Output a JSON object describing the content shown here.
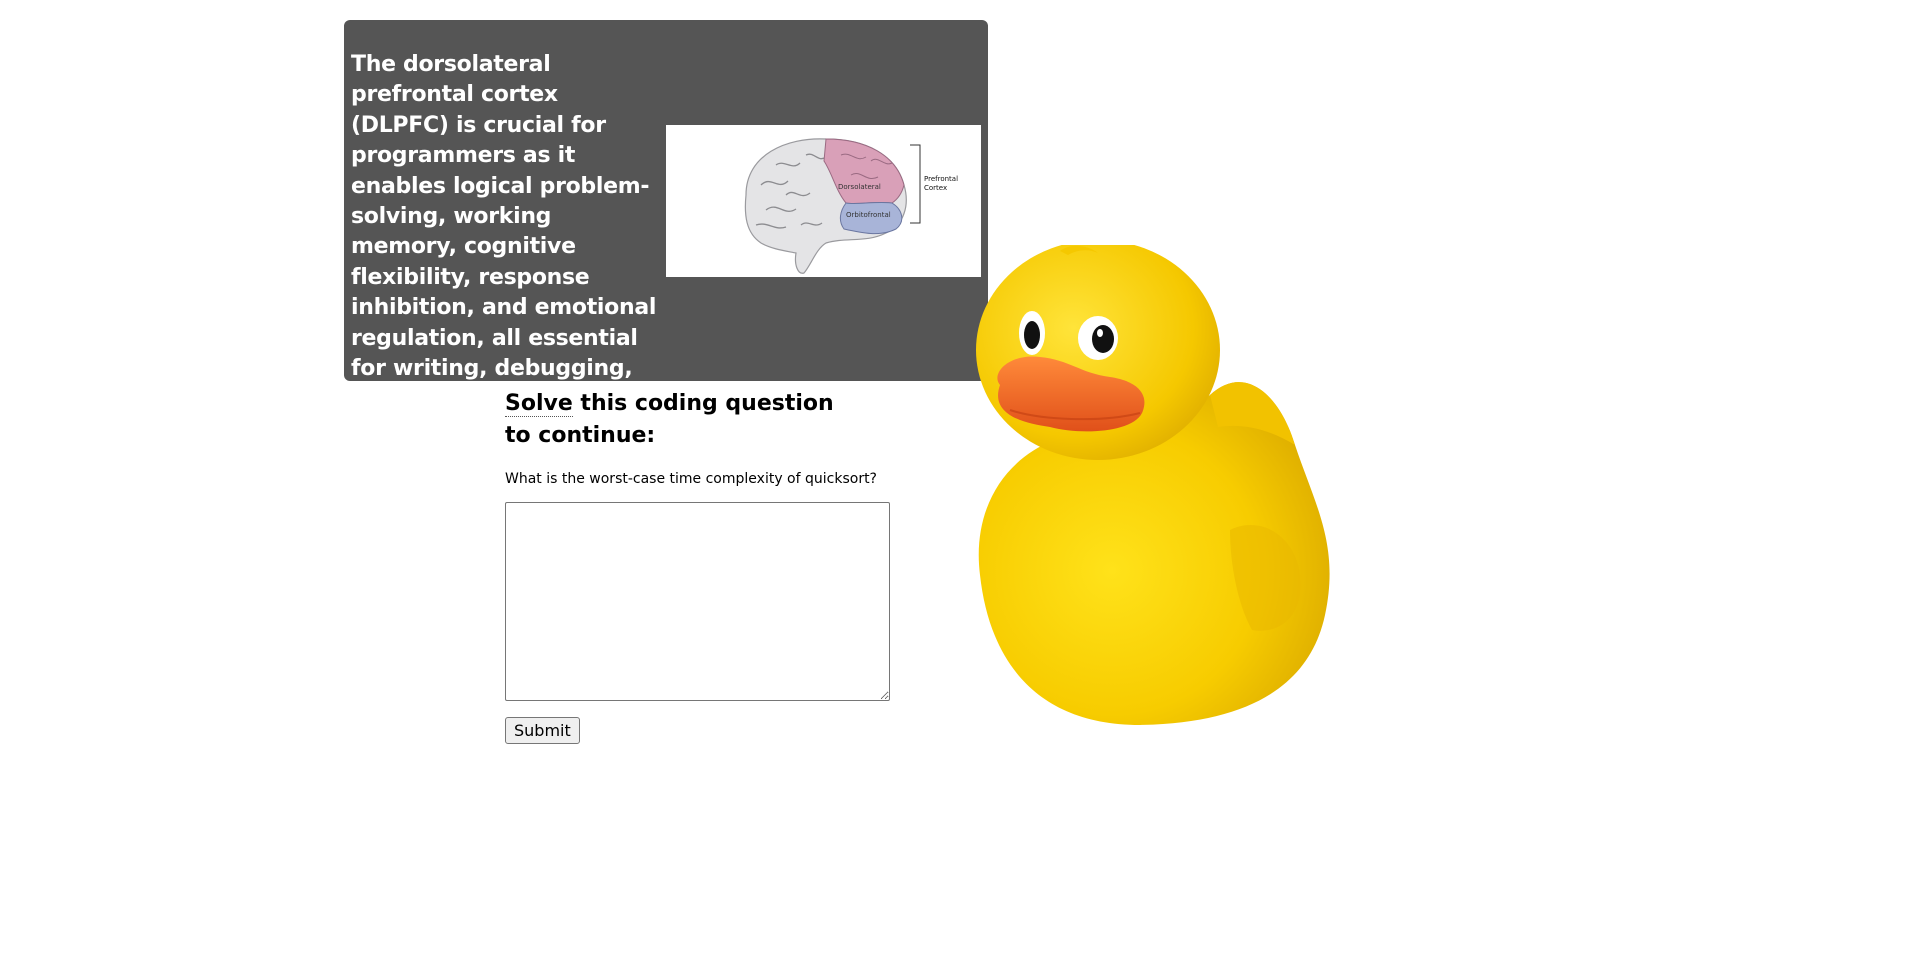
{
  "info_panel": {
    "text": "The dorsolateral prefrontal cortex (DLPFC) is crucial for programmers as it enables logical problem-solving, working memory, cognitive flexibility, response inhibition, and emotional regulation, all essential for writing, debugging, and optimizing code.",
    "figure": {
      "labels": {
        "dorsolateral": "Dorsolateral",
        "orbitofrontal": "Orbitofrontal",
        "prefrontal_line1": "Prefrontal",
        "prefrontal_line2": "Cortex"
      }
    }
  },
  "quiz": {
    "title_word1": "Solve",
    "title_rest": " this coding question to continue:",
    "question": "What is the worst-case time complexity of quicksort?",
    "answer_value": "",
    "submit_label": "Submit"
  },
  "colors": {
    "panel_bg": "#555555",
    "panel_text": "#ffffff",
    "duck_body": "#f5c800",
    "duck_beak": "#f06a1a",
    "dlpfc_region": "#d9a0b8",
    "ofc_region": "#a8b4d8"
  },
  "icons": {
    "brain": "brain-diagram",
    "duck": "rubber-duck-image"
  }
}
